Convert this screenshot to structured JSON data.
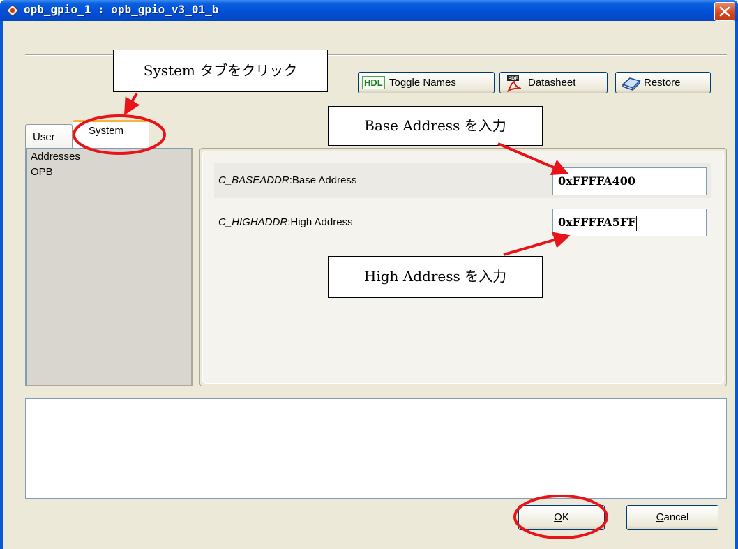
{
  "window": {
    "title": "opb_gpio_1 : opb_gpio_v3_01_b",
    "title_icon": "gear-app-icon",
    "close_icon": "close-icon"
  },
  "toolbar": {
    "toggle_names_badge": "HDL",
    "toggle_names_label": "Toggle Names",
    "datasheet_label": "Datasheet",
    "datasheet_icon": "pdf-icon",
    "restore_label": "Restore",
    "restore_icon": "restore-icon"
  },
  "tabs": [
    {
      "label": "User",
      "selected": false
    },
    {
      "label": "System",
      "selected": true
    }
  ],
  "categories": [
    "Addresses",
    "OPB"
  ],
  "params": [
    {
      "name": "C_BASEADDR",
      "label": ":Base Address",
      "value": "0xFFFFA400"
    },
    {
      "name": "C_HIGHADDR",
      "label": ":High Address",
      "value": "0xFFFFA5FF"
    }
  ],
  "buttons": {
    "ok_mnemonic": "O",
    "ok_rest": "K",
    "cancel_mnemonic": "C",
    "cancel_rest": "ancel"
  },
  "annotations": {
    "system_tab": "System タブをクリック",
    "base_address": "Base Address を入力",
    "high_address": "High Address を入力"
  },
  "colors": {
    "annotation": "#e8141a",
    "titlebar": "#0350d6",
    "window_bg": "#ece9d8"
  }
}
